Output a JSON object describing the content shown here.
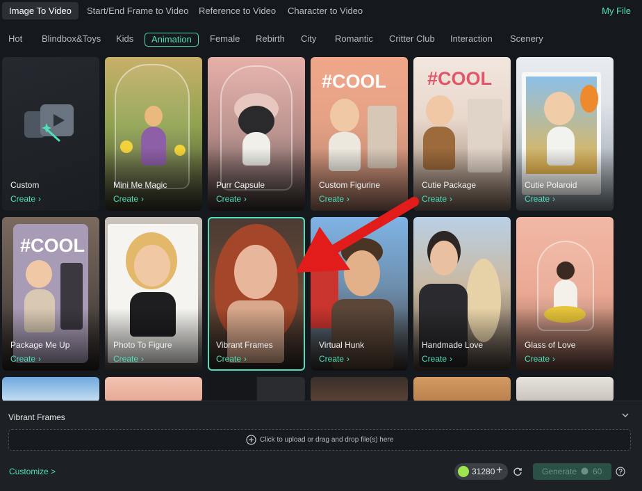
{
  "mode_tabs": [
    {
      "label": "Image To Video",
      "active": true
    },
    {
      "label": "Start/End Frame to Video",
      "active": false
    },
    {
      "label": "Reference to Video",
      "active": false
    },
    {
      "label": "Character to Video",
      "active": false
    }
  ],
  "my_file": "My File",
  "categories": [
    "Hot",
    "Blindbox&Toys",
    "Kids",
    "Animation",
    "Female",
    "Rebirth",
    "City",
    "Romantic",
    "Critter Club",
    "Interaction",
    "Scenery"
  ],
  "active_category": "Animation",
  "create_label": "Create",
  "cards": [
    {
      "title": "Custom"
    },
    {
      "title": "Mini Me Magic"
    },
    {
      "title": "Purr Capsule"
    },
    {
      "title": "Custom Figurine"
    },
    {
      "title": "Cutie Package"
    },
    {
      "title": "Cutie Polaroid"
    },
    {
      "title": "Package Me Up"
    },
    {
      "title": "Photo To Figure"
    },
    {
      "title": "Vibrant Frames",
      "selected": true
    },
    {
      "title": "Virtual Hunk"
    },
    {
      "title": "Handmade Love"
    },
    {
      "title": "Glass of Love"
    }
  ],
  "cool_text": "#COOL",
  "panel": {
    "title": "Vibrant Frames",
    "upload_text": "Click to upload or drag and drop file(s) here",
    "customize": "Customize >",
    "credits": "31280",
    "generate": "Generate",
    "generate_cost": "60"
  },
  "colors": {
    "accent": "#4fe0bb",
    "background": "#15181c",
    "arrow": "#e21b1b"
  },
  "icons": [
    "video-magic-icon",
    "chevron-right-icon",
    "chevron-down-icon",
    "plus-circle-icon",
    "credit-coin-icon",
    "plus-icon",
    "refresh-icon",
    "help-icon"
  ]
}
